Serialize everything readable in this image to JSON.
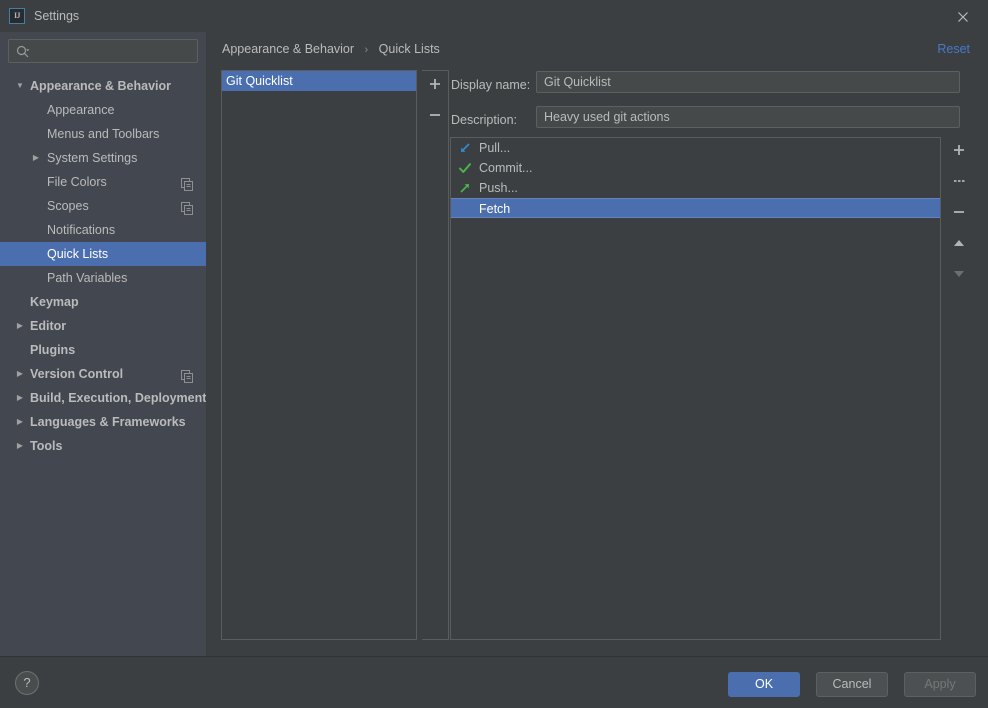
{
  "window": {
    "title": "Settings",
    "app_icon": "IJ",
    "close_icon": "close-icon"
  },
  "colors": {
    "selection_blue": "#4b6eaf",
    "link_blue": "#4878c8",
    "sidebar_bg": "#434750",
    "panel_bg": "#3c3f41",
    "text": "#bbbbbb",
    "pull_icon": "#2e8bd0",
    "commit_icon": "#4ab34a",
    "push_icon": "#4ab34a"
  },
  "search": {
    "value": "",
    "placeholder": "",
    "icon": "search-icon"
  },
  "sidebar": {
    "items": [
      {
        "label": "Appearance & Behavior",
        "depth": 0,
        "bold": true,
        "arrow": "expanded",
        "selected": false,
        "copy_icon": false
      },
      {
        "label": "Appearance",
        "depth": 1,
        "bold": false,
        "arrow": "none",
        "selected": false,
        "copy_icon": false
      },
      {
        "label": "Menus and Toolbars",
        "depth": 1,
        "bold": false,
        "arrow": "none",
        "selected": false,
        "copy_icon": false
      },
      {
        "label": "System Settings",
        "depth": 1,
        "bold": false,
        "arrow": "collapsed",
        "selected": false,
        "copy_icon": false
      },
      {
        "label": "File Colors",
        "depth": 1,
        "bold": false,
        "arrow": "none",
        "selected": false,
        "copy_icon": true
      },
      {
        "label": "Scopes",
        "depth": 1,
        "bold": false,
        "arrow": "none",
        "selected": false,
        "copy_icon": true
      },
      {
        "label": "Notifications",
        "depth": 1,
        "bold": false,
        "arrow": "none",
        "selected": false,
        "copy_icon": false
      },
      {
        "label": "Quick Lists",
        "depth": 1,
        "bold": false,
        "arrow": "none",
        "selected": true,
        "copy_icon": false
      },
      {
        "label": "Path Variables",
        "depth": 1,
        "bold": false,
        "arrow": "none",
        "selected": false,
        "copy_icon": false
      },
      {
        "label": "Keymap",
        "depth": 0,
        "bold": true,
        "arrow": "none",
        "selected": false,
        "copy_icon": false
      },
      {
        "label": "Editor",
        "depth": 0,
        "bold": true,
        "arrow": "collapsed",
        "selected": false,
        "copy_icon": false
      },
      {
        "label": "Plugins",
        "depth": 0,
        "bold": true,
        "arrow": "none",
        "selected": false,
        "copy_icon": false
      },
      {
        "label": "Version Control",
        "depth": 0,
        "bold": true,
        "arrow": "collapsed",
        "selected": false,
        "copy_icon": true
      },
      {
        "label": "Build, Execution, Deployment",
        "depth": 0,
        "bold": true,
        "arrow": "collapsed",
        "selected": false,
        "copy_icon": false
      },
      {
        "label": "Languages & Frameworks",
        "depth": 0,
        "bold": true,
        "arrow": "collapsed",
        "selected": false,
        "copy_icon": false
      },
      {
        "label": "Tools",
        "depth": 0,
        "bold": true,
        "arrow": "collapsed",
        "selected": false,
        "copy_icon": false
      }
    ]
  },
  "content": {
    "breadcrumb": {
      "parent": "Appearance & Behavior",
      "separator": "›",
      "current": "Quick Lists"
    },
    "reset_label": "Reset",
    "quicklists": {
      "items": [
        {
          "label": "Git Quicklist",
          "selected": true
        }
      ],
      "add_label": "+",
      "remove_label": "−"
    },
    "display_name": {
      "label": "Display name:",
      "value": "Git Quicklist",
      "placeholder": ""
    },
    "description": {
      "label": "Description:",
      "value": "Heavy used git actions",
      "placeholder": ""
    },
    "actions": {
      "items": [
        {
          "label": "Pull...",
          "icon": "pull-arrow-icon",
          "selected": false
        },
        {
          "label": "Commit...",
          "icon": "commit-check-icon",
          "selected": false
        },
        {
          "label": "Push...",
          "icon": "push-arrow-icon",
          "selected": false
        },
        {
          "label": "Fetch",
          "icon": "none",
          "selected": true
        }
      ],
      "toolbar": [
        {
          "name": "add-action-button",
          "icon": "plus-icon",
          "enabled": true
        },
        {
          "name": "add-separator-button",
          "icon": "separator-icon",
          "enabled": true
        },
        {
          "name": "remove-action-button",
          "icon": "minus-icon",
          "enabled": true
        },
        {
          "name": "move-action-up-button",
          "icon": "arrow-up-icon",
          "enabled": true
        },
        {
          "name": "move-action-down-button",
          "icon": "arrow-down-icon",
          "enabled": false
        }
      ]
    }
  },
  "footer": {
    "help_label": "?",
    "ok_label": "OK",
    "cancel_label": "Cancel",
    "apply_label": "Apply"
  }
}
